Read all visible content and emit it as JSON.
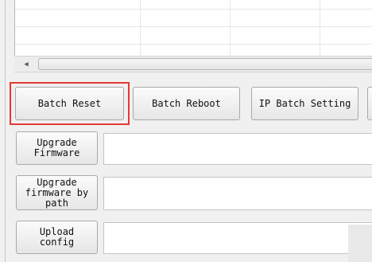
{
  "grid": {
    "rows": 3,
    "columns": 4
  },
  "scrollbar": {
    "left_arrow_glyph": "◀"
  },
  "toolbar": {
    "batch_reset_label": "Batch Reset",
    "batch_reboot_label": "Batch Reboot",
    "ip_batch_setting_label": "IP Batch Setting"
  },
  "actions": {
    "upgrade_firmware_label": "Upgrade\nFirmware",
    "upgrade_firmware_path_label": "Upgrade\nfirmware by\npath",
    "upload_config_label": "Upload\nconfig"
  },
  "fields": {
    "upgrade_firmware_value": "",
    "upgrade_firmware_path_value": "",
    "upload_config_value": ""
  },
  "colors": {
    "highlight": "#e53935",
    "background": "#f0f0f0"
  }
}
